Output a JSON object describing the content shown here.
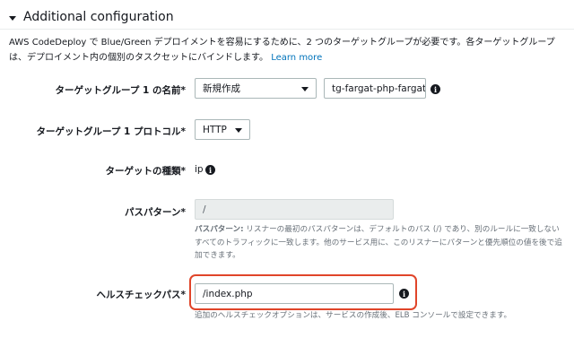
{
  "section": {
    "title": "Additional configuration",
    "description": "AWS CodeDeploy で Blue/Green デプロイメントを容易にするために、2 つのターゲットグループが必要です。各ターゲットグループは、デプロイメント内の個別のタスクセットにバインドします。",
    "learn_more": "Learn more"
  },
  "target_group_name": {
    "label": "ターゲットグループ 1 の名前*",
    "select_value": "新規作成",
    "input_value": "tg-fargat-php-fargate-"
  },
  "target_group_protocol": {
    "label": "ターゲットグループ 1 プロトコル*",
    "select_value": "HTTP"
  },
  "target_type": {
    "label": "ターゲットの種類*",
    "value": "ip"
  },
  "path_pattern": {
    "label": "パスパターン*",
    "value": "/",
    "hint_bold": "パスパターン:",
    "hint_text": " リスナーの最初のパスパターンは、デフォルトのパス (/) であり、別のルールに一致しないすべてのトラフィックに一致します。他のサービス用に、このリスナーにパターンと優先順位の値を後で追加できます。"
  },
  "health_check_path": {
    "label": "ヘルスチェックパス*",
    "value": "/index.php",
    "hint": "追加のヘルスチェックオプションは、サービスの作成後、ELB コンソールで設定できます。"
  },
  "colors": {
    "link": "#0073bb",
    "highlight": "#e0452a"
  }
}
